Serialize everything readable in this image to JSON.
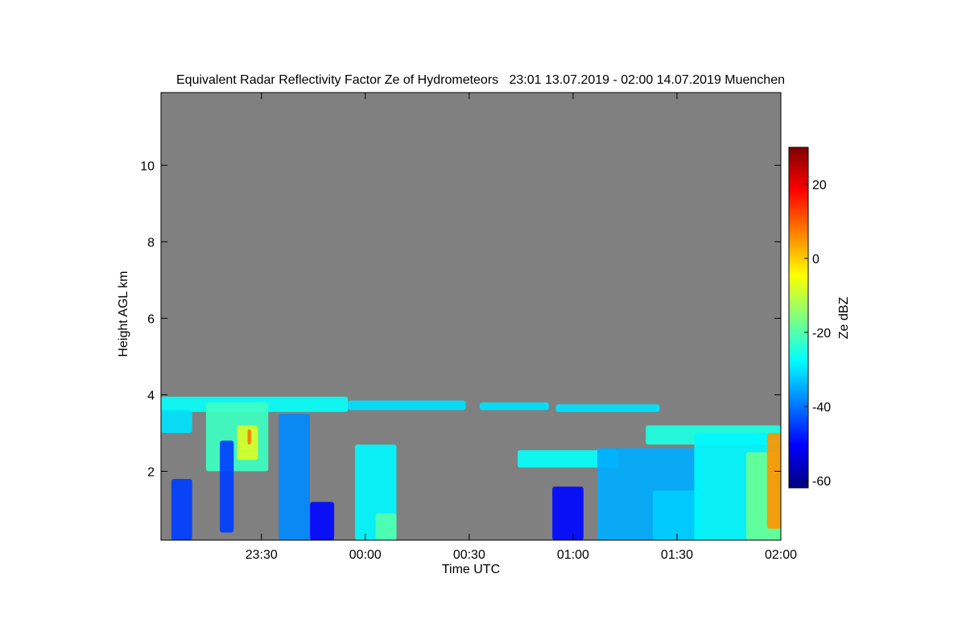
{
  "chart_data": {
    "type": "heatmap",
    "title": "Equivalent Radar Reflectivity Factor Ze of Hydrometeors   23:01 13.07.2019 - 02:00 14.07.2019 Muenchen",
    "xlabel": "Time UTC",
    "ylabel": "Height AGL km",
    "x_unit": "minutes after 23:00 UTC",
    "xlim": [
      1,
      180
    ],
    "ylim": [
      0.2,
      11.9
    ],
    "x_ticks": [
      {
        "value": 30,
        "label": "23:30"
      },
      {
        "value": 60,
        "label": "00:00"
      },
      {
        "value": 90,
        "label": "00:30"
      },
      {
        "value": 120,
        "label": "01:00"
      },
      {
        "value": 150,
        "label": "01:30"
      },
      {
        "value": 180,
        "label": "02:00"
      }
    ],
    "y_ticks": [
      {
        "value": 2,
        "label": "2"
      },
      {
        "value": 4,
        "label": "4"
      },
      {
        "value": 6,
        "label": "6"
      },
      {
        "value": 8,
        "label": "8"
      },
      {
        "value": 10,
        "label": "10"
      }
    ],
    "background_color": "#808080",
    "colorbar": {
      "label": "Ze dBZ",
      "range": [
        -62,
        30
      ],
      "ticks": [
        {
          "value": 20,
          "label": "20"
        },
        {
          "value": 0,
          "label": "0"
        },
        {
          "value": -20,
          "label": "-20"
        },
        {
          "value": -40,
          "label": "-40"
        },
        {
          "value": -60,
          "label": "-60"
        }
      ],
      "colormap": [
        "#00007f",
        "#0000ff",
        "#007fff",
        "#00ffff",
        "#7fff7f",
        "#ffff00",
        "#ff7f00",
        "#ff0000",
        "#7f0000"
      ]
    },
    "echo_regions": [
      {
        "x": [
          1,
          55
        ],
        "y": [
          3.55,
          3.95
        ],
        "ze": -27
      },
      {
        "x": [
          1,
          10
        ],
        "y": [
          3.0,
          3.6
        ],
        "ze": -30
      },
      {
        "x": [
          14,
          32
        ],
        "y": [
          2.0,
          3.8
        ],
        "ze": -22
      },
      {
        "x": [
          23,
          29
        ],
        "y": [
          2.3,
          3.2
        ],
        "ze": -8
      },
      {
        "x": [
          26,
          27
        ],
        "y": [
          2.7,
          3.1
        ],
        "ze": 8
      },
      {
        "x": [
          55,
          89
        ],
        "y": [
          3.6,
          3.85
        ],
        "ze": -30
      },
      {
        "x": [
          4,
          10
        ],
        "y": [
          0.2,
          1.8
        ],
        "ze": -45
      },
      {
        "x": [
          18,
          22
        ],
        "y": [
          0.4,
          2.8
        ],
        "ze": -45
      },
      {
        "x": [
          35,
          44
        ],
        "y": [
          0.2,
          3.5
        ],
        "ze": -38
      },
      {
        "x": [
          44,
          51
        ],
        "y": [
          0.2,
          1.2
        ],
        "ze": -50
      },
      {
        "x": [
          57,
          69
        ],
        "y": [
          0.2,
          2.7
        ],
        "ze": -28
      },
      {
        "x": [
          63,
          69
        ],
        "y": [
          0.2,
          0.9
        ],
        "ze": -20
      },
      {
        "x": [
          93,
          113
        ],
        "y": [
          3.6,
          3.8
        ],
        "ze": -30
      },
      {
        "x": [
          115,
          145
        ],
        "y": [
          3.55,
          3.75
        ],
        "ze": -30
      },
      {
        "x": [
          104,
          133
        ],
        "y": [
          2.1,
          2.55
        ],
        "ze": -27
      },
      {
        "x": [
          114,
          123
        ],
        "y": [
          0.2,
          1.6
        ],
        "ze": -50
      },
      {
        "x": [
          127,
          157
        ],
        "y": [
          0.2,
          2.6
        ],
        "ze": -35
      },
      {
        "x": [
          143,
          156
        ],
        "y": [
          0.2,
          1.5
        ],
        "ze": -32
      },
      {
        "x": [
          141,
          180
        ],
        "y": [
          2.7,
          3.2
        ],
        "ze": -25
      },
      {
        "x": [
          155,
          180
        ],
        "y": [
          0.2,
          3.0
        ],
        "ze": -28
      },
      {
        "x": [
          170,
          180
        ],
        "y": [
          0.2,
          2.5
        ],
        "ze": -18
      },
      {
        "x": [
          176,
          180
        ],
        "y": [
          0.5,
          3.0
        ],
        "ze": 5
      }
    ]
  }
}
